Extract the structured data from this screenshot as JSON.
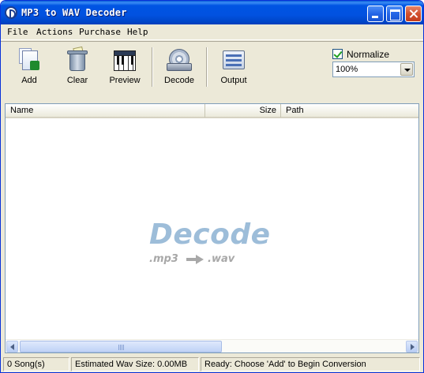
{
  "window": {
    "title": "MP3 to WAV Decoder"
  },
  "menu": {
    "items": [
      "File",
      "Actions",
      "Purchase",
      "Help"
    ]
  },
  "toolbar": {
    "buttons": [
      {
        "label": "Add",
        "icon": "add-files-icon"
      },
      {
        "label": "Clear",
        "icon": "trash-bin-icon"
      },
      {
        "label": "Preview",
        "icon": "piano-keyboard-icon"
      },
      {
        "label": "Decode",
        "icon": "disc-decode-icon"
      },
      {
        "label": "Output",
        "icon": "output-settings-icon"
      }
    ],
    "normalize": {
      "label": "Normalize",
      "checked": true,
      "level": "100%"
    }
  },
  "list": {
    "columns": [
      "Name",
      "Size",
      "Path"
    ],
    "rows": [],
    "watermark": {
      "main": "Decode",
      "from": ".mp3",
      "to": ".wav"
    }
  },
  "status": {
    "songs": "0 Song(s)",
    "estimated": "Estimated Wav Size: 0.00MB",
    "message": "Ready: Choose 'Add' to Begin Conversion"
  },
  "colors": {
    "titlebar": "#0054e3",
    "watermark_main": "#9dbdd9",
    "watermark_sub": "#a8a8a8",
    "face": "#ece9d8"
  }
}
